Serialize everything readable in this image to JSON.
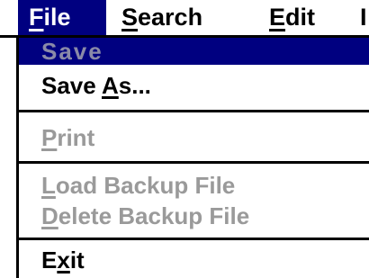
{
  "menubar": {
    "items": [
      {
        "pre": "",
        "mnemonic": "F",
        "post": "ile"
      },
      {
        "pre": "",
        "mnemonic": "S",
        "post": "earch"
      },
      {
        "pre": "",
        "mnemonic": "E",
        "post": "dit"
      },
      {
        "pre": "",
        "mnemonic": "",
        "post": "I"
      }
    ],
    "active_index": 0
  },
  "file_menu": {
    "items": [
      {
        "pre": "Save",
        "mnemonic": "",
        "post": "",
        "state": "selected"
      },
      {
        "pre": "Save ",
        "mnemonic": "A",
        "post": "s...",
        "state": "enabled"
      },
      {
        "pre": "",
        "mnemonic": "P",
        "post": "rint",
        "state": "disabled"
      },
      {
        "pre": "",
        "mnemonic": "L",
        "post": "oad Backup File",
        "state": "disabled"
      },
      {
        "pre": "",
        "mnemonic": "D",
        "post": "elete Backup File",
        "state": "disabled"
      },
      {
        "pre": "E",
        "mnemonic": "x",
        "post": "it",
        "state": "enabled"
      }
    ]
  },
  "colors": {
    "highlight": "#000080",
    "disabled_text": "#9a9a9a",
    "text": "#000000",
    "background": "#ffffff"
  }
}
